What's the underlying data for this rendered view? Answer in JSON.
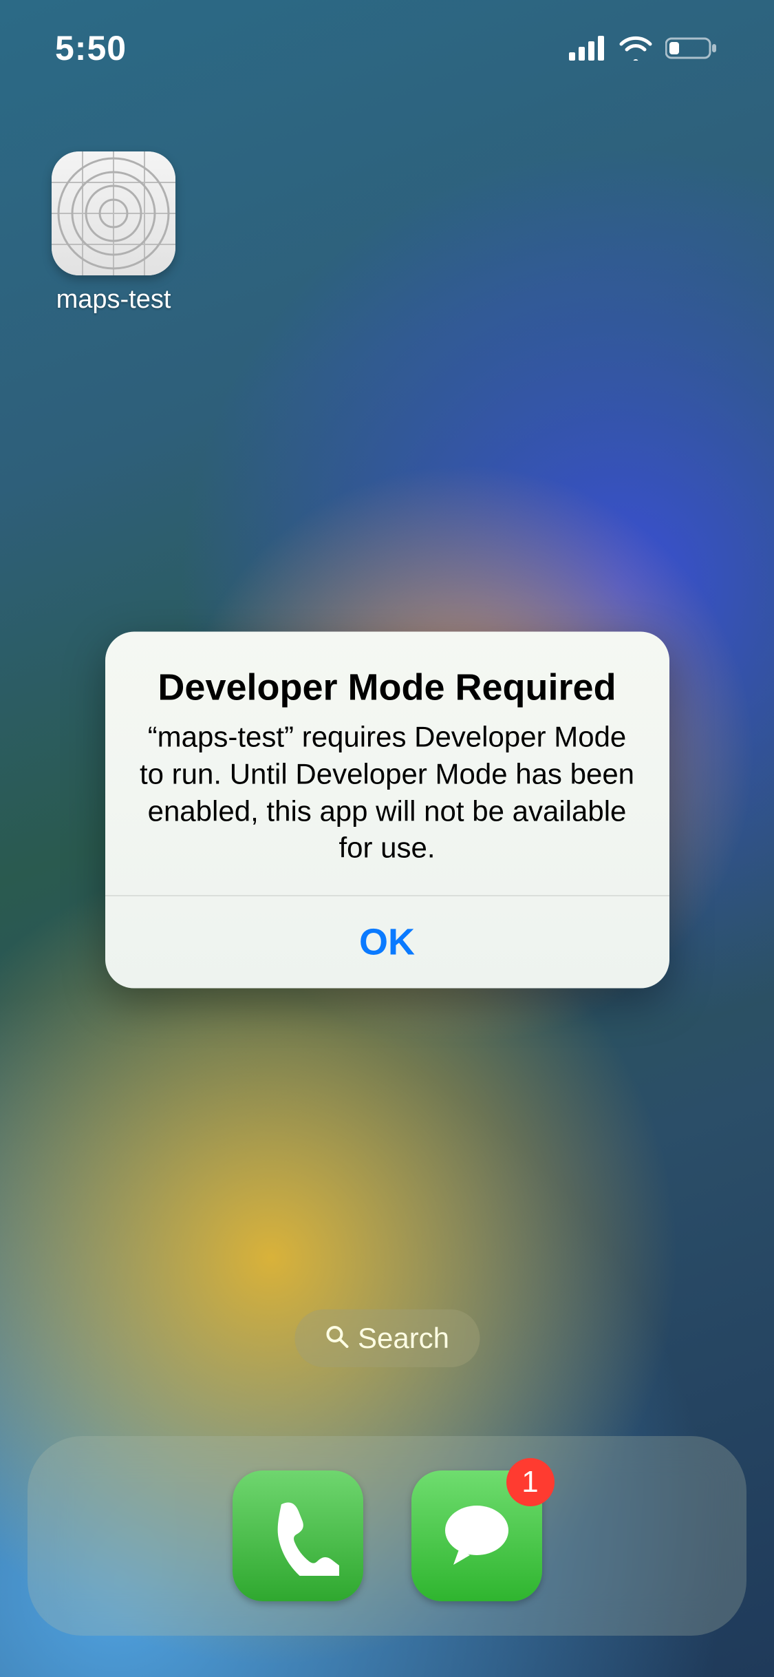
{
  "status": {
    "time": "5:50",
    "cellular_bars": 4,
    "wifi": true,
    "battery_low": true
  },
  "home": {
    "apps": [
      {
        "label": "maps-test",
        "icon": "placeholder-app-icon"
      }
    ]
  },
  "search": {
    "label": "Search"
  },
  "dock": {
    "items": [
      {
        "name": "phone-app",
        "badge": null
      },
      {
        "name": "messages-app",
        "badge": "1"
      }
    ]
  },
  "alert": {
    "title": "Developer Mode Required",
    "message": "“maps-test” requires Developer Mode to run. Until Developer Mode has been enabled, this app will not be available for use.",
    "ok_label": "OK"
  }
}
